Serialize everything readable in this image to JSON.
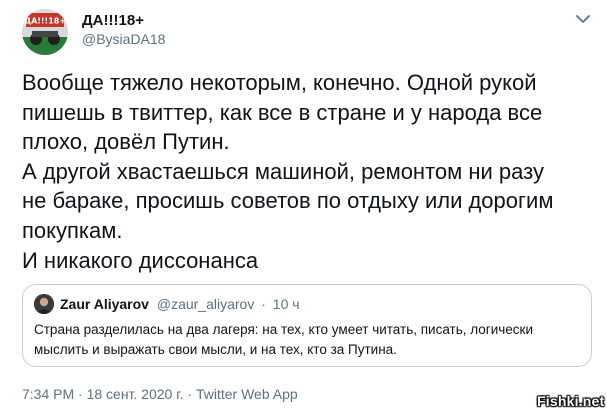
{
  "author": {
    "name": "ДА!!!18+",
    "handle": "@BysiaDA18",
    "avatar_label": "ДА!!!18+"
  },
  "tweet": {
    "lines": [
      "Вообще тяжело некоторым, конечно. Одной рукой",
      "пишешь в твиттер, как все в стране и у народа все",
      "плохо, довёл Путин.",
      "А другой хвастаешься машиной, ремонтом ни разу",
      "не бараке, просишь советов по отдыху или дорогим",
      "покупкам.",
      "И никакого диссонанса"
    ]
  },
  "quote": {
    "name": "Zaur Aliyarov",
    "handle": "@zaur_aliyarov",
    "dot": "·",
    "time": "10 ч",
    "lines": [
      "Страна разделилась на два лагеря: на тех, кто умеет читать, писать, логически",
      "мыслить и выражать свои мысли, и на тех, кто за Путина."
    ]
  },
  "meta": {
    "timestamp": "7:34 PM · 18 сент. 2020 г. · Twitter Web App"
  },
  "watermark": "Fishki.net",
  "icons": {
    "menu": "chevron-down-icon"
  },
  "colors": {
    "text": "#0f1419",
    "secondary": "#5b7083",
    "border": "#c4cfd6"
  }
}
